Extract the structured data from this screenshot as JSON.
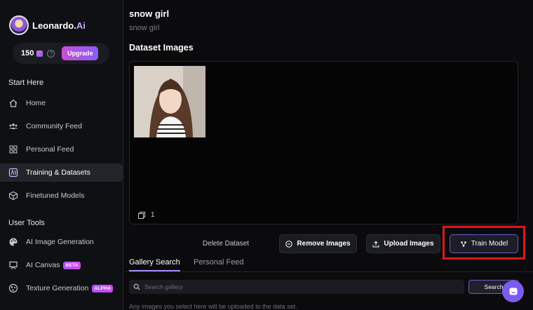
{
  "brand": {
    "name": "Leonardo.",
    "suffix": "Ai"
  },
  "credits": {
    "count": "150",
    "upgrade_label": "Upgrade"
  },
  "sidebar": {
    "start_here_label": "Start Here",
    "start_items": [
      {
        "label": "Home",
        "icon": "home-icon"
      },
      {
        "label": "Community Feed",
        "icon": "community-icon"
      },
      {
        "label": "Personal Feed",
        "icon": "grid-icon"
      },
      {
        "label": "Training & Datasets",
        "icon": "training-icon",
        "active": true
      },
      {
        "label": "Finetuned Models",
        "icon": "cube-icon"
      }
    ],
    "user_tools_label": "User Tools",
    "tool_items": [
      {
        "label": "AI Image Generation",
        "icon": "palette-icon"
      },
      {
        "label": "AI Canvas",
        "icon": "canvas-icon",
        "badge": "BETA"
      },
      {
        "label": "Texture Generation",
        "icon": "texture-icon",
        "badge": "ALPHA"
      }
    ]
  },
  "dataset": {
    "title": "snow girl",
    "subtitle": "snow girl",
    "section_title": "Dataset Images",
    "image_count": "1"
  },
  "actions": {
    "delete_label": "Delete Dataset",
    "remove_label": "Remove Images",
    "upload_label": "Upload Images",
    "train_label": "Train Model"
  },
  "tabs": [
    {
      "label": "Gallery Search",
      "active": true
    },
    {
      "label": "Personal Feed",
      "active": false
    }
  ],
  "search": {
    "placeholder": "Search gallery",
    "button_label": "Search",
    "hint": "Any images you select here will be uploaded to the data set."
  },
  "colors": {
    "accent": "#a78bfa",
    "highlight": "#e0161b",
    "brand_gradient_start": "#c94fd8",
    "brand_gradient_end": "#8b5cf6"
  }
}
